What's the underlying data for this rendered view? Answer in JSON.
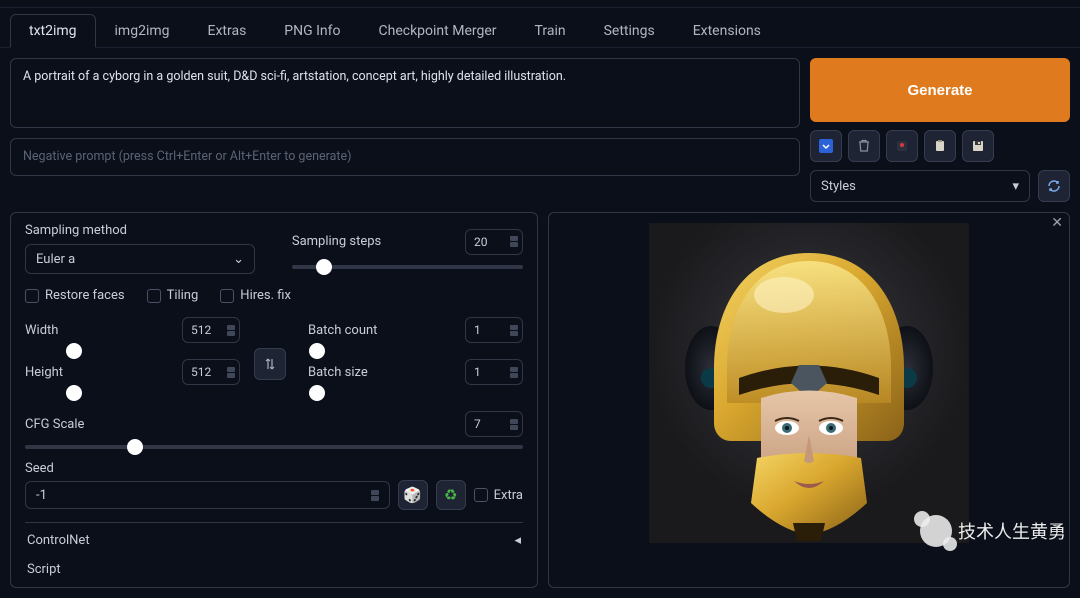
{
  "tabs": [
    "txt2img",
    "img2img",
    "Extras",
    "PNG Info",
    "Checkpoint Merger",
    "Train",
    "Settings",
    "Extensions"
  ],
  "activeTab": 0,
  "prompt": "A portrait of a cyborg in a golden suit, D&D sci-fi, artstation, concept art, highly detailed illustration.",
  "negPlaceholder": "Negative prompt (press Ctrl+Enter or Alt+Enter to generate)",
  "generateLabel": "Generate",
  "stylesLabel": "Styles",
  "sampling": {
    "methodLabel": "Sampling method",
    "methodValue": "Euler a",
    "stepsLabel": "Sampling steps",
    "stepsValue": "20"
  },
  "checks": {
    "restore": "Restore faces",
    "tiling": "Tiling",
    "hires": "Hires. fix"
  },
  "dims": {
    "widthLabel": "Width",
    "width": "512",
    "heightLabel": "Height",
    "height": "512"
  },
  "batch": {
    "countLabel": "Batch count",
    "count": "1",
    "sizeLabel": "Batch size",
    "size": "1"
  },
  "cfg": {
    "label": "CFG Scale",
    "value": "7"
  },
  "seed": {
    "label": "Seed",
    "value": "-1",
    "extraLabel": "Extra"
  },
  "controlnetLabel": "ControlNet",
  "scriptLabel": "Script",
  "watermarkText": "技术人生黄勇"
}
